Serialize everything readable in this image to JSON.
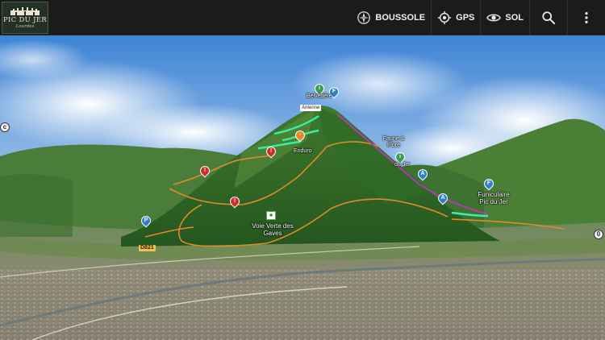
{
  "app": {
    "logo": {
      "title": "PIC DU JER",
      "subtitle": "Lourdes"
    },
    "toolbar": {
      "compass": {
        "label": "BOUSSOLE",
        "icon": "compass-icon"
      },
      "gps": {
        "label": "GPS",
        "icon": "gps-crosshair-icon"
      },
      "ground": {
        "label": "SOL",
        "icon": "eye-icon"
      },
      "search": {
        "icon": "search-icon"
      },
      "menu": {
        "icon": "more-vert-icon"
      }
    }
  },
  "map": {
    "labels": {
      "voie_verte": "Voie Verte des Gaves",
      "funiculaire": "Funiculaire Pic du Jer",
      "faune": "Faune & Flore",
      "du_jer": "du Jer",
      "enduro": "Enduro",
      "antenne": "Antenne",
      "belvedere": "Belvédère",
      "road": "D821"
    },
    "edge_markers": {
      "left": "c",
      "right": "0"
    },
    "colors": {
      "trail_orange": "#e08a2a",
      "trail_green": "#35f0a0",
      "funicular_magenta": "#d12ad0",
      "sky": "#4f8fd8"
    }
  }
}
